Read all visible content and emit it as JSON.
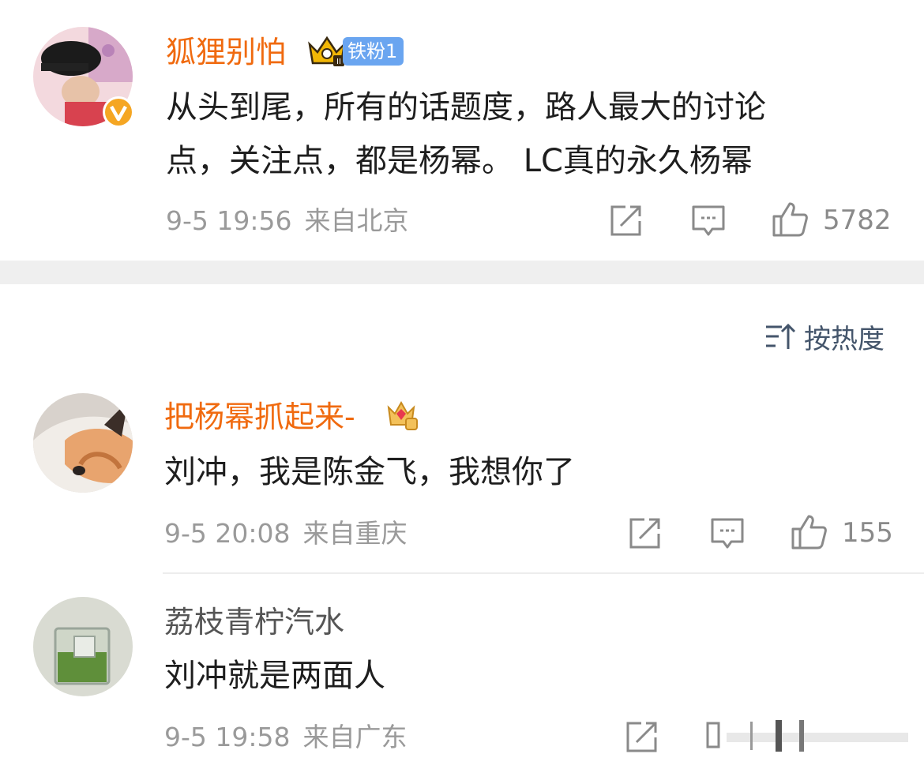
{
  "top_comment": {
    "username": "狐狸别怕",
    "fan_badge": "铁粉1",
    "text_line1": "从头到尾，所有的话题度，路人最大的讨论",
    "text_line2": "点，关注点，都是杨幂。 LC真的永久杨幂",
    "time": "9-5 19:56",
    "location": "来自北京",
    "likes": "5782"
  },
  "sort": {
    "label": "按热度"
  },
  "comments": [
    {
      "username": "把杨幂抓起来-",
      "text": "刘冲，我是陈金飞，我想你了",
      "time": "9-5 20:08",
      "location": "来自重庆",
      "likes": "155"
    },
    {
      "username": "荔枝青柠汽水",
      "text": "刘冲就是两面人",
      "time": "9-5 19:58",
      "location": "来自广东"
    }
  ],
  "colors": {
    "username_orange": "#f06a0f",
    "meta_gray": "#9a9a9a",
    "fan_badge_blue": "#6aa5f0",
    "verified_gold": "#f5a623"
  },
  "icons": [
    "repost-icon",
    "comment-icon",
    "like-icon",
    "crown-badge-icon",
    "verified-icon",
    "sort-icon",
    "gem-crown-icon"
  ]
}
